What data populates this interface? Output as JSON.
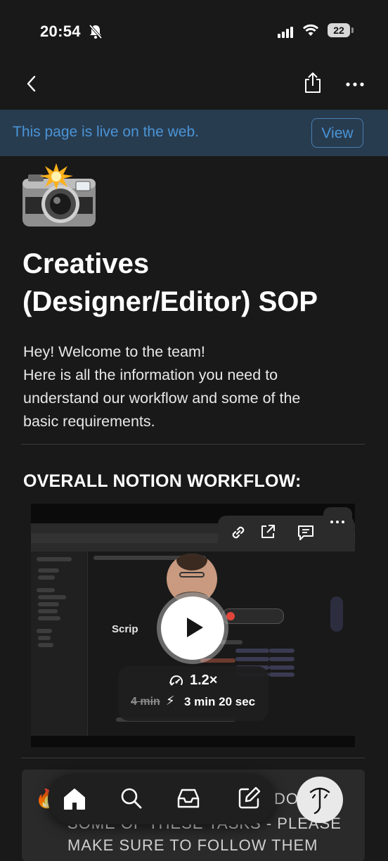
{
  "status_bar": {
    "time": "20:54",
    "battery": "22"
  },
  "banner": {
    "text": "This page is live on the web.",
    "button": "View"
  },
  "page": {
    "title_line1": "Creatives",
    "title_line2": "(Designer/Editor) SOP",
    "intro_lines": [
      "Hey! Welcome to the team!",
      "Here is all the information you need to",
      "understand our workflow and some of the",
      "basic requirements."
    ],
    "section_heading": "OVERALL NOTION WORKFLOW:"
  },
  "video": {
    "speed": "1.2×",
    "original_time": "4 min",
    "new_time": "3 min 20 sec",
    "embedded_tab_title": "Scrip"
  },
  "callout": {
    "line1": "DO",
    "line2": "SOME OF THESE TASKS - PLEASE",
    "line3": "MAKE SURE TO FOLLOW THEM"
  },
  "colors": {
    "background": "#191919",
    "banner_bg": "#283c50",
    "banner_text": "#4a94d6",
    "callout_bg": "#2a2a2a"
  },
  "icons": {
    "status": [
      "bell-off-icon",
      "signal-icon",
      "wifi-icon",
      "battery-icon"
    ],
    "nav": [
      "back-icon",
      "share-icon",
      "more-icon"
    ],
    "video_toolbar": [
      "link-icon",
      "open-external-icon",
      "comment-icon",
      "more-icon"
    ],
    "tab_bar": [
      "home-icon",
      "search-icon",
      "inbox-icon",
      "compose-icon",
      "assistant-icon"
    ]
  }
}
